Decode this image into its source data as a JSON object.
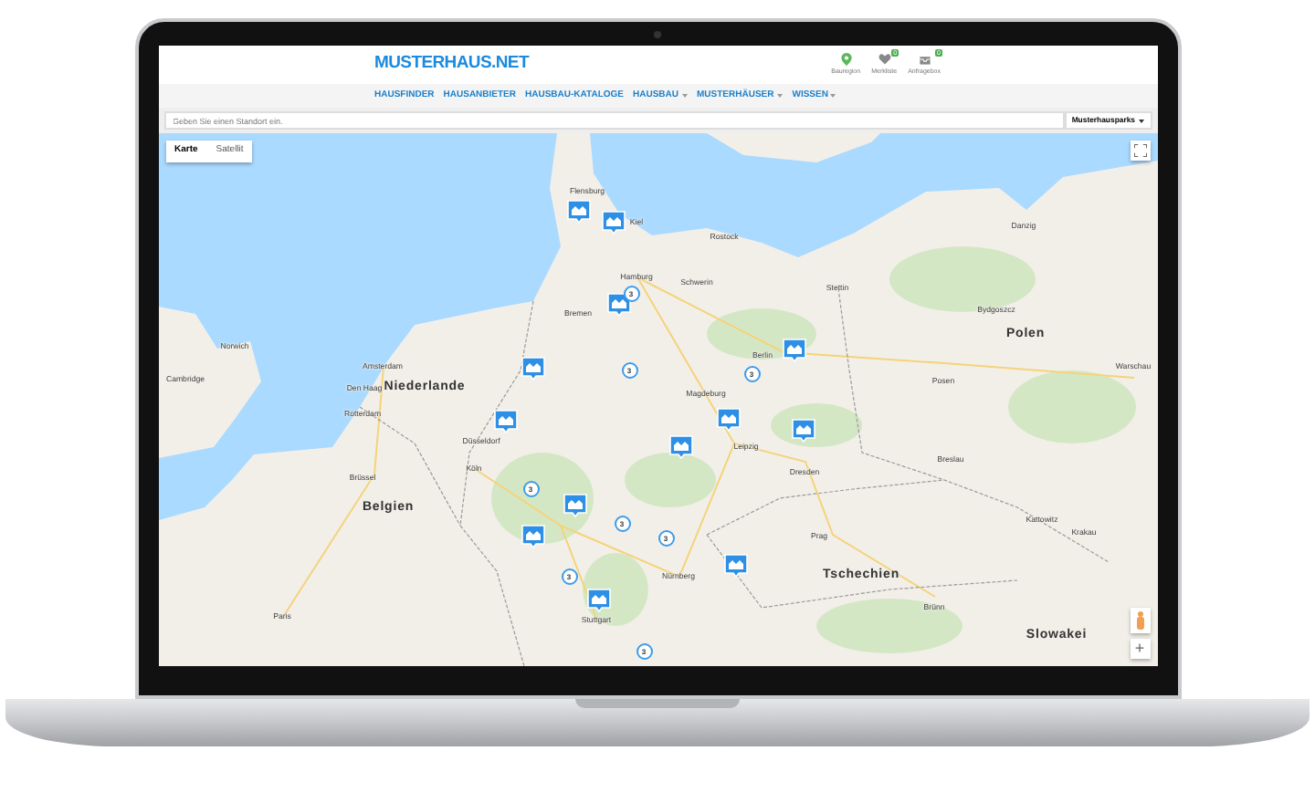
{
  "site": {
    "logo": "MUSTERHAUS.NET",
    "header_links": [
      {
        "label": "Bauregion",
        "kind": "pin"
      },
      {
        "label": "Merkliste",
        "kind": "heart",
        "badge": "0"
      },
      {
        "label": "Anfragebox",
        "kind": "inbox",
        "badge": "0"
      }
    ],
    "nav": [
      {
        "label": "HAUSFINDER",
        "dropdown": false
      },
      {
        "label": "HAUSANBIETER",
        "dropdown": false
      },
      {
        "label": "HAUSBAU-KATALOGE",
        "dropdown": false
      },
      {
        "label": "HAUSBAU",
        "dropdown": true
      },
      {
        "label": "MUSTERHÄUSER",
        "dropdown": true
      },
      {
        "label": "WISSEN",
        "dropdown": true
      }
    ],
    "search": {
      "placeholder": "Geben Sie einen Standort ein.",
      "filter": "Musterhausparks"
    }
  },
  "map": {
    "map_types": [
      {
        "label": "Karte",
        "selected": true
      },
      {
        "label": "Satellit",
        "selected": false
      }
    ],
    "places": [
      {
        "name": "Polen",
        "kind": "country"
      },
      {
        "name": "Niederlande",
        "kind": "country"
      },
      {
        "name": "Belgien",
        "kind": "country"
      },
      {
        "name": "Tschechien",
        "kind": "country"
      },
      {
        "name": "Slowakei",
        "kind": "country"
      },
      {
        "name": "Flensburg",
        "kind": "city"
      },
      {
        "name": "Kiel",
        "kind": "city"
      },
      {
        "name": "Hamburg",
        "kind": "city"
      },
      {
        "name": "Bremen",
        "kind": "city"
      },
      {
        "name": "Rostock",
        "kind": "city"
      },
      {
        "name": "Schwerin",
        "kind": "city"
      },
      {
        "name": "Stettin",
        "kind": "city"
      },
      {
        "name": "Danzig",
        "kind": "city"
      },
      {
        "name": "Bydgoszcz",
        "kind": "city"
      },
      {
        "name": "Posen",
        "kind": "city"
      },
      {
        "name": "Warschau",
        "kind": "city"
      },
      {
        "name": "Berlin",
        "kind": "city"
      },
      {
        "name": "Magdeburg",
        "kind": "city"
      },
      {
        "name": "Amsterdam",
        "kind": "city"
      },
      {
        "name": "Den Haag",
        "kind": "city"
      },
      {
        "name": "Rotterdam",
        "kind": "city"
      },
      {
        "name": "Norwich",
        "kind": "city"
      },
      {
        "name": "Cambridge",
        "kind": "city"
      },
      {
        "name": "Brüssel",
        "kind": "city"
      },
      {
        "name": "Paris",
        "kind": "city"
      },
      {
        "name": "Düsseldorf",
        "kind": "city"
      },
      {
        "name": "Köln",
        "kind": "city"
      },
      {
        "name": "Leipzig",
        "kind": "city"
      },
      {
        "name": "Dresden",
        "kind": "city"
      },
      {
        "name": "Breslau",
        "kind": "city"
      },
      {
        "name": "Kattowitz",
        "kind": "city"
      },
      {
        "name": "Krakau",
        "kind": "city"
      },
      {
        "name": "Prag",
        "kind": "city"
      },
      {
        "name": "Brünn",
        "kind": "city"
      },
      {
        "name": "Nürnberg",
        "kind": "city"
      },
      {
        "name": "Stuttgart",
        "kind": "city"
      }
    ],
    "markers": [
      {
        "kind": "house"
      },
      {
        "kind": "house"
      },
      {
        "kind": "house"
      },
      {
        "kind": "house"
      },
      {
        "kind": "house"
      },
      {
        "kind": "house"
      },
      {
        "kind": "house"
      },
      {
        "kind": "house"
      },
      {
        "kind": "house"
      },
      {
        "kind": "house"
      },
      {
        "kind": "house"
      },
      {
        "kind": "house"
      },
      {
        "kind": "house"
      },
      {
        "kind": "cluster",
        "count": "3"
      },
      {
        "kind": "cluster",
        "count": "3"
      },
      {
        "kind": "cluster",
        "count": "3"
      },
      {
        "kind": "cluster",
        "count": "3"
      },
      {
        "kind": "cluster",
        "count": "3"
      },
      {
        "kind": "cluster",
        "count": "3"
      },
      {
        "kind": "cluster",
        "count": "3"
      },
      {
        "kind": "cluster",
        "count": "3"
      }
    ],
    "zoom_in": "+"
  }
}
